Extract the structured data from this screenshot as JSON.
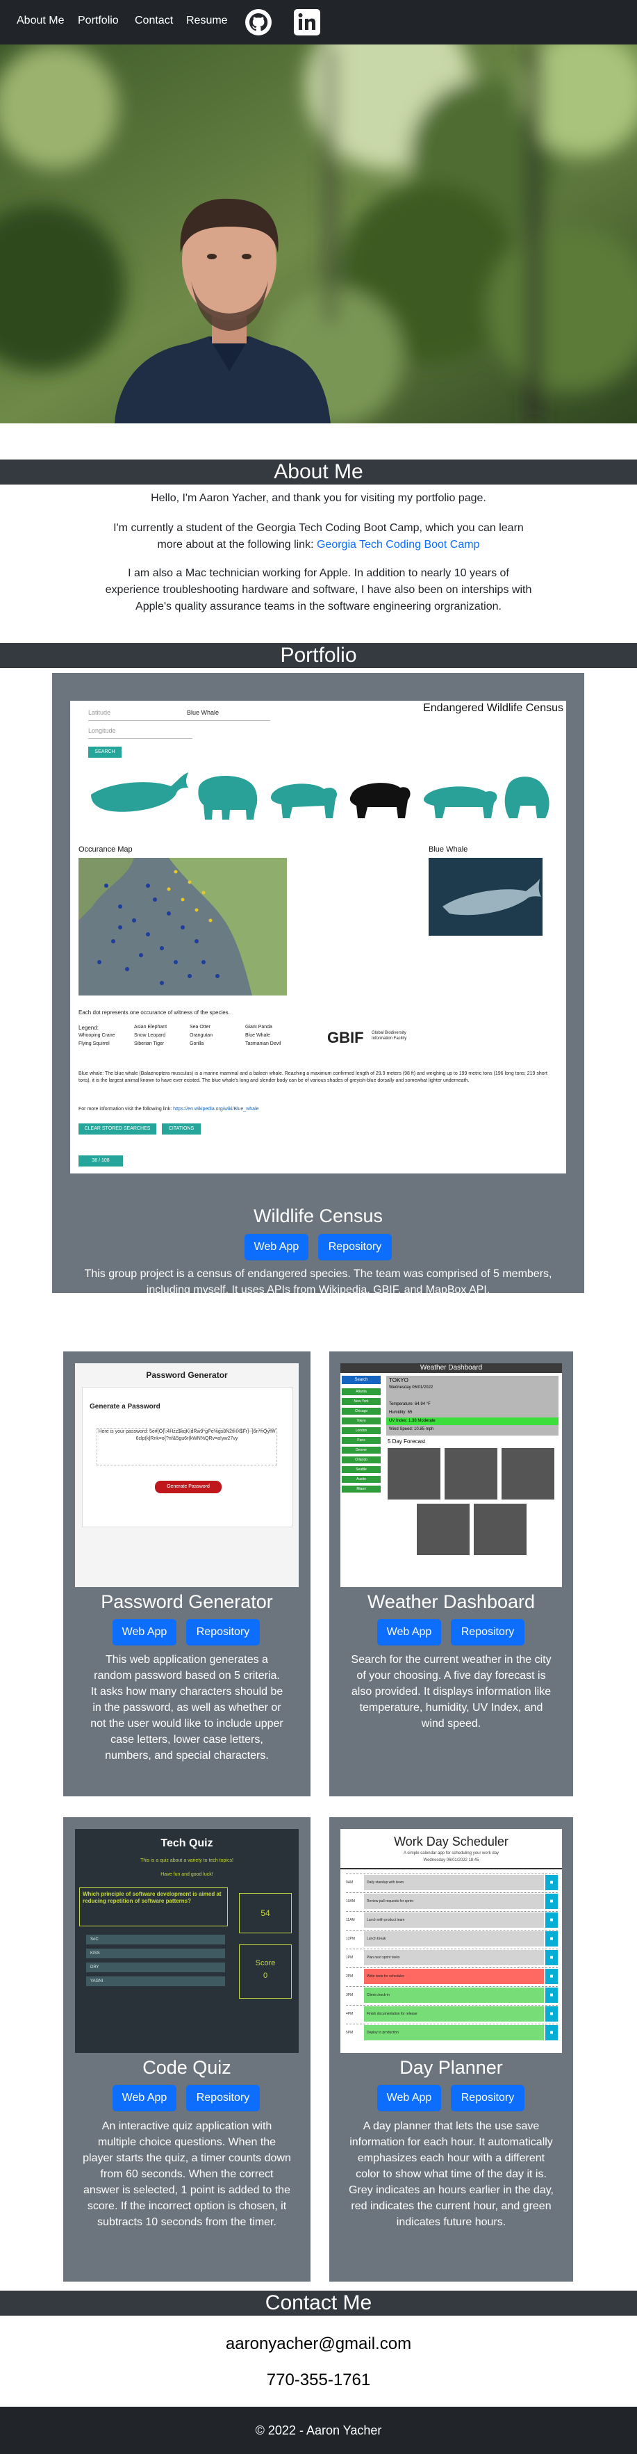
{
  "nav": {
    "links": [
      "About Me",
      "Portfolio",
      "Contact",
      "Resume"
    ],
    "icons": [
      "github-icon",
      "linkedin-icon"
    ]
  },
  "about": {
    "heading": "About Me",
    "p1": "Hello, I'm Aaron Yacher, and thank you for visiting my portfolio page.",
    "p2": "I'm currently a student of the Georgia Tech Coding Boot Camp, which you can learn more about at the following link:",
    "p2_link": "Georgia Tech Coding Boot Camp",
    "p3": "I am also a Mac technician working for Apple. In addition to nearly 10 years of experience troubleshooting hardware and software, I have also been on interships with Apple's quality assurance teams in the software engineering orgranization."
  },
  "portfolio": {
    "heading": "Portfolio",
    "featured": {
      "title": "Wildlife Census",
      "web_app_label": "Web App",
      "repo_label": "Repository",
      "description": "This group project is a census of endangered species. The team was comprised of 5 members, including myself. It uses APIs from Wikipedia, GBIF, and MapBox API.",
      "screenshot": {
        "city_placeholder": "Latitude",
        "lon_placeholder": "Longitude",
        "select_value": "Blue Whale",
        "search_label": "SEARCH",
        "app_title": "Endangered Wildlife Census",
        "map_heading": "Occurance Map",
        "species_heading": "Blue Whale",
        "map_caption": "Each dot represents one occurance of witness of the species.",
        "legend_title": "Legend:",
        "legend": [
          "Whooping Crane",
          "Flying Squirrel",
          "Asian Elephant",
          "Snow Leopard",
          "Siberian Tiger",
          "Sea Otter",
          "Orangutan",
          "Gorilla",
          "Giant Panda",
          "Blue Whale",
          "Tasmanian Devil"
        ],
        "gbif_label": "GBIF",
        "gbif_sub": "Global Biodiversity Information Facility",
        "body_text": "Blue whale: The blue whale (Balaenoptera musculus) is a marine mammal and a baleen whale. Reaching a maximum confirmed length of 29.9 meters (98 ft) and weighing up to 199 metric tons (196 long tons; 219 short tons), it is the largest animal known to have ever existed. The blue whale's long and slender body can be of various shades of greyish-blue dorsally and somewhat lighter underneath.",
        "more_info": "For more information visit the following link:",
        "more_link": "https://en.wikipedia.org/wiki/Blue_whale",
        "btn_clear": "CLEAR STORED SEARCHES",
        "btn_citations": "CITATIONS",
        "pager": "38 / 108"
      }
    },
    "projects": [
      {
        "title": "Password Generator",
        "web_app_label": "Web App",
        "repo_label": "Repository",
        "description": "This web application generates a random password based on 5 criteria. It asks how many characters should be in the password, as well as whether or not the user would like to include upper case letters, lower case letters, numbers, and special characters.",
        "screenshot": {
          "title": "Password Generator",
          "subtitle": "Generate a Password",
          "output": "Here is your password: 5e#[O{\\:4Hzz$kqK(dRw9*gPe%gs8N2tHX$Fr)~]6n*hQyfW6clp(k]Rnk=o{?nf&5gu6r(kWN%QRv=a!yw27vy",
          "button": "Generate Password"
        }
      },
      {
        "title": "Weather Dashboard",
        "web_app_label": "Web App",
        "repo_label": "Repository",
        "description": "Search for the current weather in the city of your choosing. A five day forecast is also provided. It displays information like temperature, humidity, UV Index, and wind speed.",
        "screenshot": {
          "title": "Weather Dashboard",
          "city": "TOKYO",
          "date": "Wednesday 06/01/2022",
          "rows": [
            "Temperature: 64.94 °F",
            "Humidity: 65",
            "UV Index: 1.38 Moderate",
            "Wind Speed: 10.85 mph"
          ],
          "forecast_label": "5 Day Forecast",
          "sidebar": [
            "Search",
            "Atlanta",
            "New York",
            "Chicago",
            "Tokyo",
            "London",
            "Paris",
            "Denver",
            "Orlando",
            "Seattle",
            "Austin",
            "Miami"
          ]
        }
      },
      {
        "title": "Code Quiz",
        "web_app_label": "Web App",
        "repo_label": "Repository",
        "description": "An interactive quiz application with multiple choice questions. When the player starts the quiz, a timer counts down from 60 seconds. When the correct answer is selected, 1 point is added to the score. If the incorrect option is chosen, it subtracts 10 seconds from the timer.",
        "screenshot": {
          "title": "Tech Quiz",
          "line1": "This is a quiz about a variety to tech topics!",
          "line2": "Have fun and good luck!",
          "question": "Which principle of software development is aimed at reducing repetition of software patterns?",
          "options": [
            "SoC",
            "KISS",
            "DRY",
            "YAGNI"
          ],
          "timer": "54",
          "score_label": "Score",
          "score": "0"
        }
      },
      {
        "title": "Day Planner",
        "web_app_label": "Web App",
        "repo_label": "Repository",
        "description": "A day planner that lets the use save information for each hour. It automatically emphasizes each hour with a different color to show what time of the day it is. Grey indicates an hours earlier in the day, red indicates the current hour, and green indicates future hours.",
        "screenshot": {
          "title": "Work Day Scheduler",
          "subtitle": "A simple calendar app for scheduling your work day",
          "date": "Wednesday 06/01/2022 18:45",
          "hours": [
            "9AM",
            "10AM",
            "11AM",
            "12PM",
            "1PM",
            "2PM",
            "3PM",
            "4PM",
            "5PM"
          ],
          "entries": [
            "Daily standup with team",
            "Review pull requests for sprint",
            "Lunch with product team",
            "Lunch break",
            "Plan next sprint tasks",
            "Write tests for scheduler",
            "Client check-in",
            "Finish documentation for release",
            "Deploy to production"
          ],
          "states": [
            "past",
            "past",
            "past",
            "past",
            "past",
            "present",
            "future",
            "future",
            "future"
          ]
        }
      }
    ]
  },
  "contact": {
    "heading": "Contact Me",
    "email": "aaronyacher@gmail.com",
    "phone": "770-355-1761"
  },
  "footer": {
    "text": "© 2022 - Aaron Yacher"
  },
  "colors": {
    "nav": "#212529",
    "section": "#343a40",
    "card": "#6c757d",
    "button": "#0d6efd",
    "link": "#0d6efd",
    "teal": "#26a69a"
  }
}
